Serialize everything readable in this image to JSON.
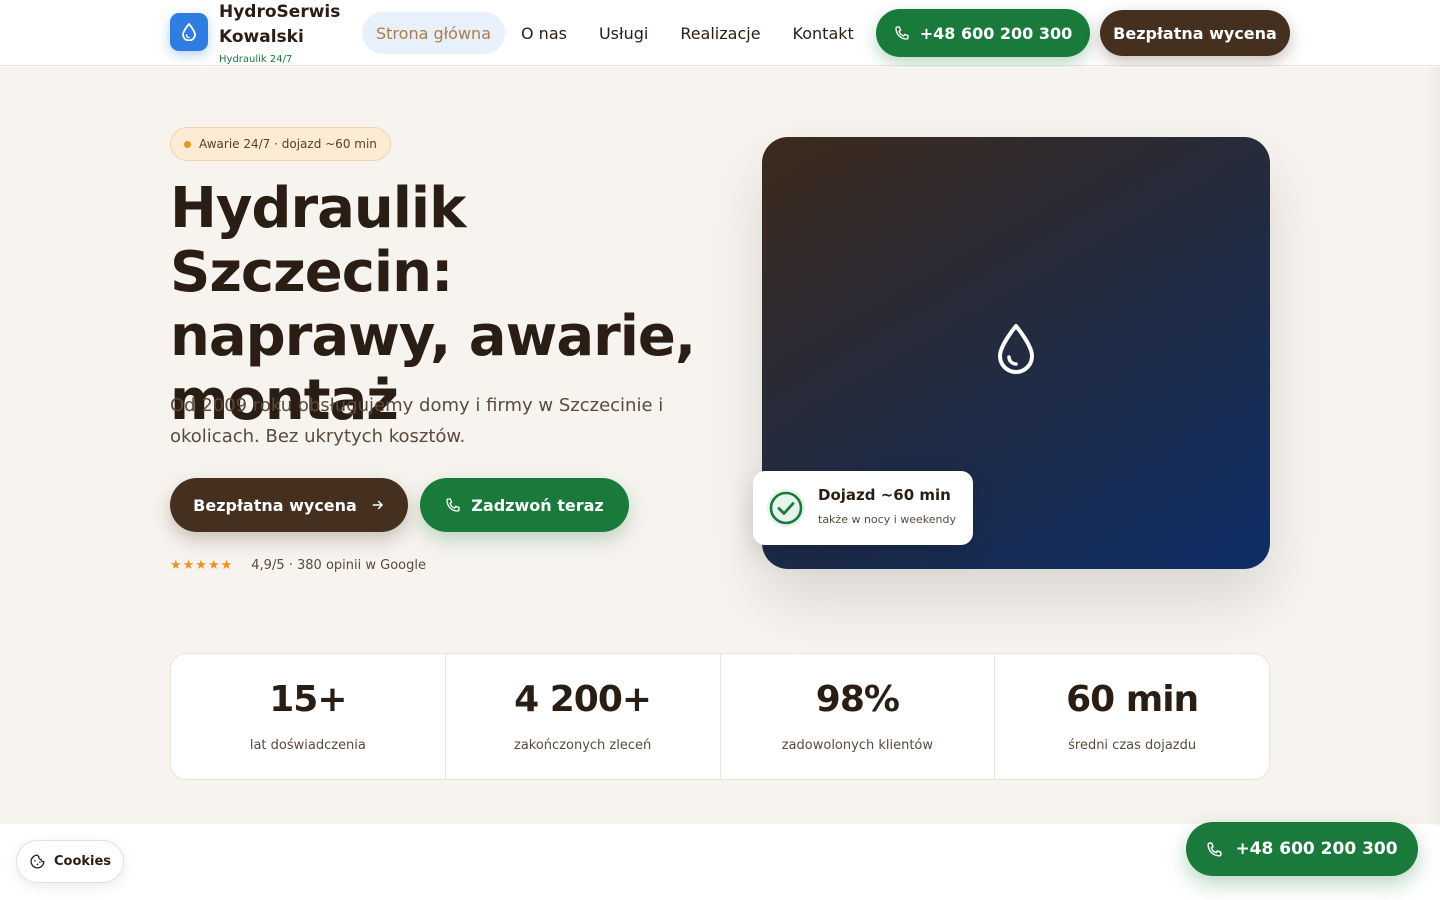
{
  "brand": {
    "name": "HydroSerwis Kowalski",
    "tagline": "Hydraulik 24/7",
    "logo_icon": "water-drop-icon"
  },
  "nav": {
    "items": [
      {
        "label": "Strona główna",
        "active": true
      },
      {
        "label": "O nas",
        "active": false
      },
      {
        "label": "Usługi",
        "active": false
      },
      {
        "label": "Realizacje",
        "active": false
      },
      {
        "label": "Kontakt",
        "active": false
      }
    ],
    "phone_label": "+48 600 200 300",
    "quote_label": "Bezpłatna wycena"
  },
  "hero": {
    "badge": "Awarie 24/7 · dojazd ~60 min",
    "title": "Hydraulik Szczecin: naprawy, awarie, montaż",
    "subtitle": "Od 2009 roku obsługujemy domy i firmy w Szczecinie i okolicach. Bez ukrytych kosztów.",
    "quote_button": "Bezpłatna wycena",
    "call_button": "Zadzwoń teraz",
    "stars": "★★★★★",
    "rating_text": "4,9/5 · 380 opinii w Google",
    "eta_card": {
      "title": "Dojazd ~60 min",
      "subtitle": "także w nocy i weekendy"
    }
  },
  "stats": [
    {
      "value": "15+",
      "label": "lat doświadczenia"
    },
    {
      "value": "4 200+",
      "label": "zakończonych zleceń"
    },
    {
      "value": "98%",
      "label": "zadowolonych klientów"
    },
    {
      "value": "60 min",
      "label": "średni czas dojazdu"
    }
  ],
  "floating": {
    "cookies_label": "Cookies",
    "phone_label": "+48 600 200 300"
  },
  "colors": {
    "primary_green": "#1a7a3c",
    "primary_brown": "#45301f",
    "accent_blue": "#2f7de1",
    "accent_orange": "#e8941f",
    "hero_bg": "#f7f3ee"
  }
}
